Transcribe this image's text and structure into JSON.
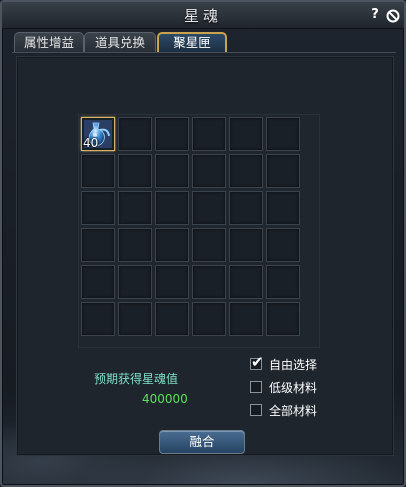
{
  "window": {
    "title": "星魂"
  },
  "tabs": [
    {
      "label": "属性增益",
      "active": false
    },
    {
      "label": "道具兑换",
      "active": false
    },
    {
      "label": "聚星匣",
      "active": true
    }
  ],
  "grid": {
    "rows": 6,
    "cols": 6,
    "items": [
      {
        "row": 0,
        "col": 0,
        "icon": "blue-potion-flask-icon",
        "count": "40"
      }
    ]
  },
  "expected": {
    "label": "预期获得星魂值",
    "value": "400000"
  },
  "options": [
    {
      "label": "自由选择",
      "checked": true
    },
    {
      "label": "低级材料",
      "checked": false
    },
    {
      "label": "全部材料",
      "checked": false
    }
  ],
  "buttons": {
    "fuse_label": "融合"
  },
  "colors": {
    "accent_gold": "#c9a24d",
    "label_teal": "#7fe0c6",
    "value_green": "#59e05a"
  }
}
